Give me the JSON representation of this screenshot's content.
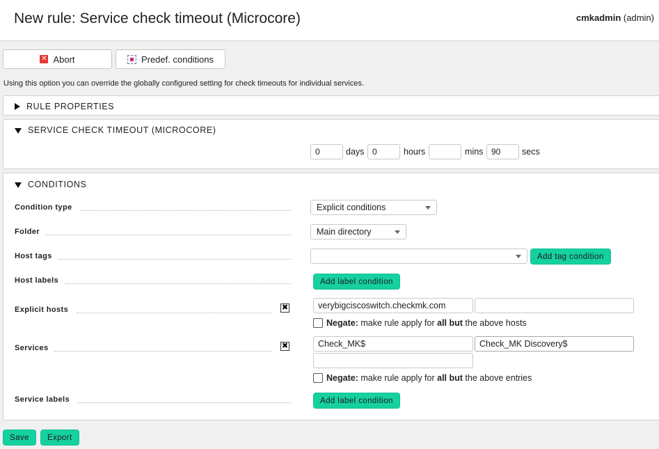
{
  "header": {
    "title": "New rule: Service check timeout (Microcore)",
    "username": "cmkadmin",
    "role": "(admin)"
  },
  "actions": {
    "abort_label": "Abort",
    "predef_label": "Predef. conditions"
  },
  "intro_text": "Using this option you can override the globally configured setting for check timeouts for individual services.",
  "rule_properties": {
    "title": "RULE PROPERTIES"
  },
  "timeout": {
    "title": "SERVICE CHECK TIMEOUT (MICROCORE)",
    "days_value": "0",
    "days_unit": "days",
    "hours_value": "0",
    "hours_unit": "hours",
    "mins_value": "",
    "mins_unit": "mins",
    "secs_value": "90",
    "secs_unit": "secs"
  },
  "conditions": {
    "title": "CONDITIONS",
    "condition_type": {
      "label": "Condition type",
      "value": "Explicit conditions"
    },
    "folder": {
      "label": "Folder",
      "value": "Main directory"
    },
    "host_tags": {
      "label": "Host tags",
      "value": "",
      "button": "Add tag condition"
    },
    "host_labels": {
      "label": "Host labels",
      "button": "Add label condition"
    },
    "explicit_hosts": {
      "label": "Explicit hosts",
      "values": [
        "verybigciscoswitch.checkmk.com",
        ""
      ],
      "negate_bold": "Negate:",
      "negate_text_1": "make rule apply for",
      "negate_all_but": "all but",
      "negate_text_2": "the above hosts"
    },
    "services": {
      "label": "Services",
      "values": [
        "Check_MK$",
        "Check_MK Discovery$",
        ""
      ],
      "negate_bold": "Negate:",
      "negate_text_1": "make rule apply for",
      "negate_all_but": "all but",
      "negate_text_2": "the above entries"
    },
    "service_labels": {
      "label": "Service labels",
      "button": "Add label condition"
    }
  },
  "footer": {
    "save_label": "Save",
    "export_label": "Export"
  },
  "colors": {
    "accent_green": "#15d1a0",
    "abort_red": "#e53935"
  }
}
